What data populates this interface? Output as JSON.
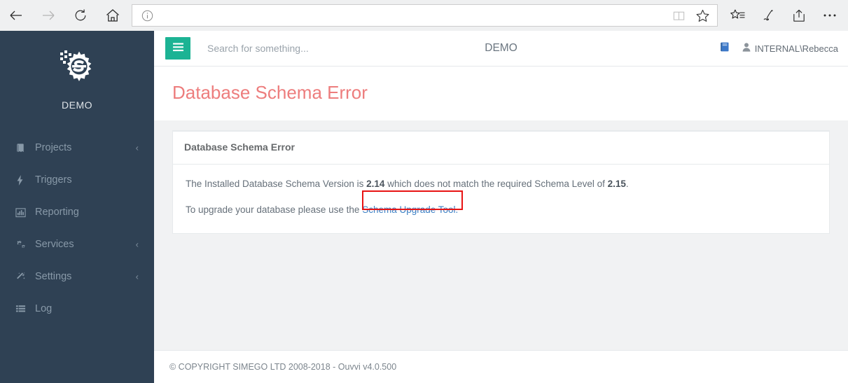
{
  "browser": {
    "back_label": "Back",
    "forward_label": "Forward",
    "refresh_label": "Refresh",
    "home_label": "Home",
    "address_value": "",
    "address_placeholder": "",
    "info_icon": "info-circle-icon",
    "reading_view_icon": "book-icon",
    "favorite_icon": "star-icon",
    "hub_icon": "favorites-hub-icon",
    "notes_icon": "pen-icon",
    "share_icon": "share-icon",
    "more_icon": "ellipsis-icon"
  },
  "sidebar": {
    "brand_name": "DEMO",
    "logo_icon": "simego-gear-s-logo",
    "items": [
      {
        "label": "Projects",
        "icon": "book-icon",
        "caret": "‹",
        "has_caret": true
      },
      {
        "label": "Triggers",
        "icon": "bolt-icon",
        "caret": "",
        "has_caret": false
      },
      {
        "label": "Reporting",
        "icon": "bar-chart-icon",
        "caret": "",
        "has_caret": false
      },
      {
        "label": "Services",
        "icon": "gears-icon",
        "caret": "‹",
        "has_caret": true
      },
      {
        "label": "Settings",
        "icon": "magic-wand-icon",
        "caret": "‹",
        "has_caret": true
      },
      {
        "label": "Log",
        "icon": "list-icon",
        "caret": "",
        "has_caret": false
      }
    ]
  },
  "topbar": {
    "menu_icon": "hamburger-icon",
    "search_value": "",
    "search_placeholder": "Search for something...",
    "environment": "DEMO",
    "manual_icon": "book-icon",
    "user_icon": "user-icon",
    "user_name": "INTERNAL\\Rebecca"
  },
  "page": {
    "title": "Database Schema Error"
  },
  "panel": {
    "title": "Database Schema Error",
    "line1_part1": "The Installed Database Schema Version is ",
    "line1_installed_version": "2.14",
    "line1_part2": " which does not match the required Schema Level of ",
    "line1_required_version": "2.15",
    "line1_part3": ".",
    "line2_part1": "To upgrade your database please use the ",
    "line2_link_text": "Schema Upgrade Tool.",
    "annotation_color": "#e81313"
  },
  "footer": {
    "text": "© COPYRIGHT SIMEGO LTD 2008-2018 - Ouvvi v4.0.500"
  },
  "colors": {
    "sidebar_bg": "#2f4154",
    "accent_green": "#1cb394",
    "title_red": "#ed7d7d",
    "link_blue": "#3b7fc4",
    "content_bg": "#f1f2f3"
  }
}
